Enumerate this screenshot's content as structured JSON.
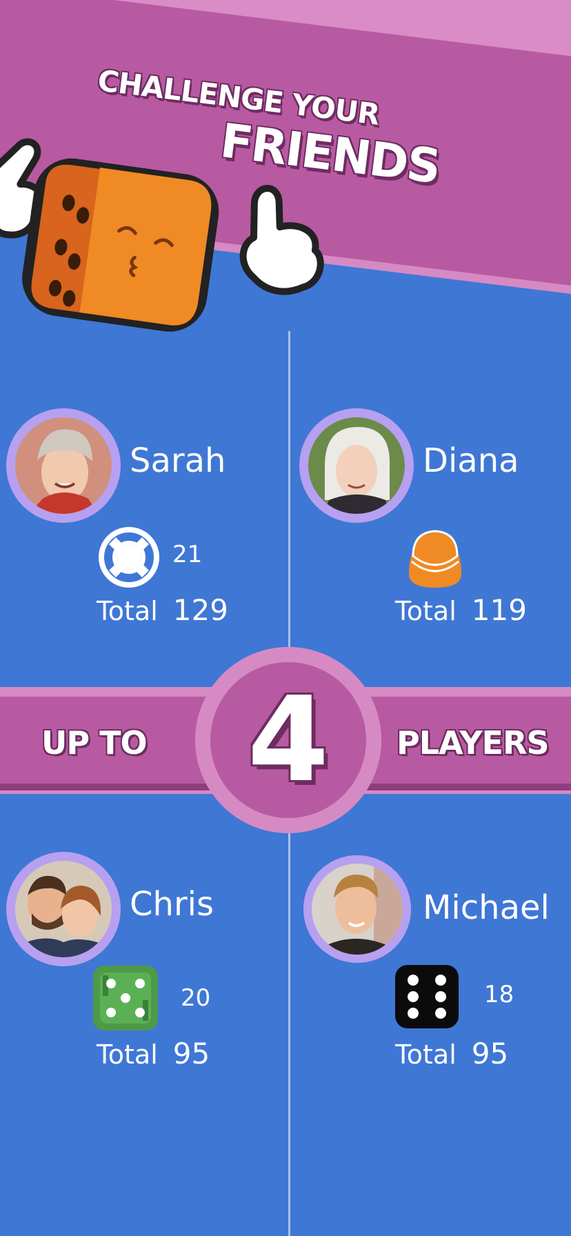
{
  "banner": {
    "headline_line1": "CHALLENGE YOUR",
    "headline_line2": "FRIENDS"
  },
  "middle_banner": {
    "left_text": "UP TO",
    "number": "4",
    "right_text": "PLAYERS"
  },
  "players": [
    {
      "name": "Sarah",
      "token_icon": "lifebuoy-icon",
      "count": "21",
      "total_label": "Total",
      "total": "129"
    },
    {
      "name": "Diana",
      "token_icon": "orange-pawn-icon",
      "count": "",
      "total_label": "Total",
      "total": "119"
    },
    {
      "name": "Chris",
      "token_icon": "green-dice-icon",
      "count": "20",
      "total_label": "Total",
      "total": "95"
    },
    {
      "name": "Michael",
      "token_icon": "black-dice-icon",
      "count": "18",
      "total_label": "Total",
      "total": "95"
    }
  ],
  "colors": {
    "background": "#3f77d5",
    "banner": "#b85aa2",
    "banner_light": "#d68ac4",
    "avatar_ring": "#b7a0f0",
    "dice_orange": "#f08a24"
  }
}
